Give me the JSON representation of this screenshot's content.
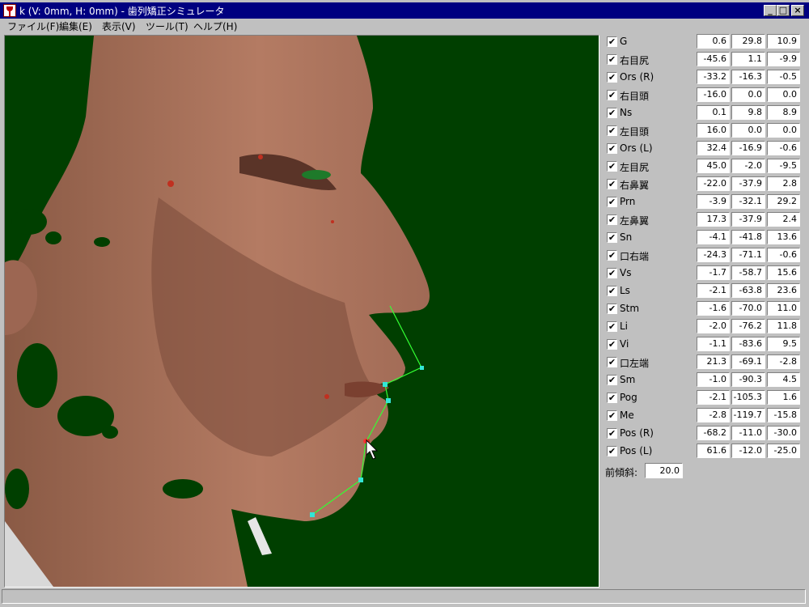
{
  "window": {
    "title": "k (V: 0mm, H: 0mm) - 歯列矯正シミュレータ",
    "buttons": {
      "minimize": "_",
      "maximize": "□",
      "close": "×"
    }
  },
  "menu": [
    "ファイル(F)",
    "編集(E)",
    "表示(V)",
    "ツール(T)",
    "ヘルプ(H)"
  ],
  "landmarks": [
    {
      "name": "G",
      "checked": true,
      "x": "0.6",
      "y": "29.8",
      "z": "10.9"
    },
    {
      "name": "右目尻",
      "checked": true,
      "x": "-45.6",
      "y": "1.1",
      "z": "-9.9"
    },
    {
      "name": "Ors (R)",
      "checked": true,
      "x": "-33.2",
      "y": "-16.3",
      "z": "-0.5"
    },
    {
      "name": "右目頭",
      "checked": true,
      "x": "-16.0",
      "y": "0.0",
      "z": "0.0"
    },
    {
      "name": "Ns",
      "checked": true,
      "x": "0.1",
      "y": "9.8",
      "z": "8.9"
    },
    {
      "name": "左目頭",
      "checked": true,
      "x": "16.0",
      "y": "0.0",
      "z": "0.0"
    },
    {
      "name": "Ors (L)",
      "checked": true,
      "x": "32.4",
      "y": "-16.9",
      "z": "-0.6"
    },
    {
      "name": "左目尻",
      "checked": true,
      "x": "45.0",
      "y": "-2.0",
      "z": "-9.5"
    },
    {
      "name": "右鼻翼",
      "checked": true,
      "x": "-22.0",
      "y": "-37.9",
      "z": "2.8"
    },
    {
      "name": "Prn",
      "checked": true,
      "x": "-3.9",
      "y": "-32.1",
      "z": "29.2"
    },
    {
      "name": "左鼻翼",
      "checked": true,
      "x": "17.3",
      "y": "-37.9",
      "z": "2.4"
    },
    {
      "name": "Sn",
      "checked": true,
      "x": "-4.1",
      "y": "-41.8",
      "z": "13.6"
    },
    {
      "name": "口右端",
      "checked": true,
      "x": "-24.3",
      "y": "-71.1",
      "z": "-0.6"
    },
    {
      "name": "Vs",
      "checked": true,
      "x": "-1.7",
      "y": "-58.7",
      "z": "15.6"
    },
    {
      "name": "Ls",
      "checked": true,
      "x": "-2.1",
      "y": "-63.8",
      "z": "23.6"
    },
    {
      "name": "Stm",
      "checked": true,
      "x": "-1.6",
      "y": "-70.0",
      "z": "11.0"
    },
    {
      "name": "Li",
      "checked": true,
      "x": "-2.0",
      "y": "-76.2",
      "z": "11.8"
    },
    {
      "name": "Vi",
      "checked": true,
      "x": "-1.1",
      "y": "-83.6",
      "z": "9.5"
    },
    {
      "name": "口左端",
      "checked": true,
      "x": "21.3",
      "y": "-69.1",
      "z": "-2.8"
    },
    {
      "name": "Sm",
      "checked": true,
      "x": "-1.0",
      "y": "-90.3",
      "z": "4.5"
    },
    {
      "name": "Pog",
      "checked": true,
      "x": "-2.1",
      "y": "-105.3",
      "z": "1.6"
    },
    {
      "name": "Me",
      "checked": true,
      "x": "-2.8",
      "y": "-119.7",
      "z": "-15.8"
    },
    {
      "name": "Pos (R)",
      "checked": true,
      "x": "-68.2",
      "y": "-11.0",
      "z": "-30.0"
    },
    {
      "name": "Pos (L)",
      "checked": true,
      "x": "61.6",
      "y": "-12.0",
      "z": "-25.0"
    }
  ],
  "tilt": {
    "label": "前傾斜:",
    "value": "20.0"
  },
  "check_glyph": "✔",
  "colors": {
    "viewport_bg": "#003f00",
    "profile_line": "#33ff33",
    "marker": "#33e6d6",
    "title_bar": "#000080"
  }
}
